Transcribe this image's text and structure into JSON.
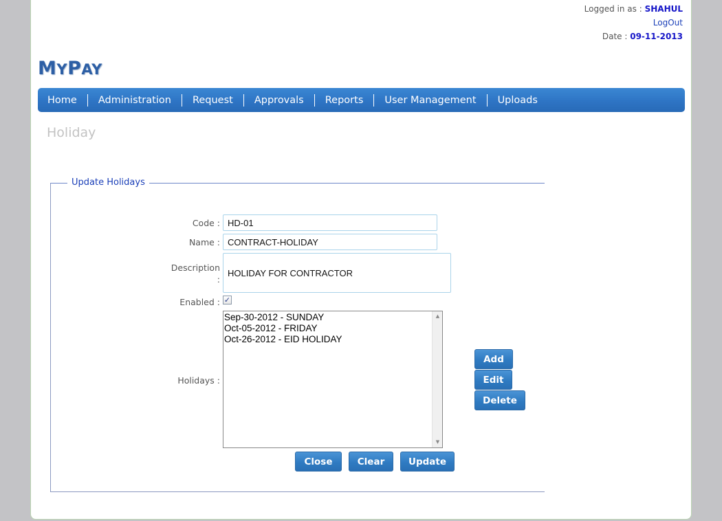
{
  "header": {
    "logged_in_label": "Logged in as :",
    "username": "SHAHUL",
    "logout_label": "LogOut",
    "date_label": "Date :",
    "date_value": "09-11-2013"
  },
  "logo": {
    "first_big": "M",
    "first_small": "Y",
    "second_big": "P",
    "second_small": "AY"
  },
  "nav": {
    "items": [
      {
        "label": "Home"
      },
      {
        "label": "Administration"
      },
      {
        "label": "Request"
      },
      {
        "label": "Approvals"
      },
      {
        "label": "Reports"
      },
      {
        "label": "User Management"
      },
      {
        "label": "Uploads"
      }
    ]
  },
  "page": {
    "title": "Holiday"
  },
  "form": {
    "legend": "Update Holidays",
    "code_label": "Code :",
    "code_value": "HD-01",
    "name_label": "Name :",
    "name_value": "CONTRACT-HOLIDAY",
    "description_label": "Description",
    "description_colon": ":",
    "description_value": "HOLIDAY FOR CONTRACTOR",
    "enabled_label": "Enabled :",
    "enabled_checked": true,
    "holidays_label": "Holidays :",
    "holidays": [
      "Sep-30-2012 - SUNDAY",
      "Oct-05-2012 - FRIDAY",
      "Oct-26-2012 - EID HOLIDAY"
    ],
    "add_label": "Add",
    "edit_label": "Edit",
    "delete_label": "Delete",
    "close_label": "Close",
    "clear_label": "Clear",
    "update_label": "Update"
  }
}
